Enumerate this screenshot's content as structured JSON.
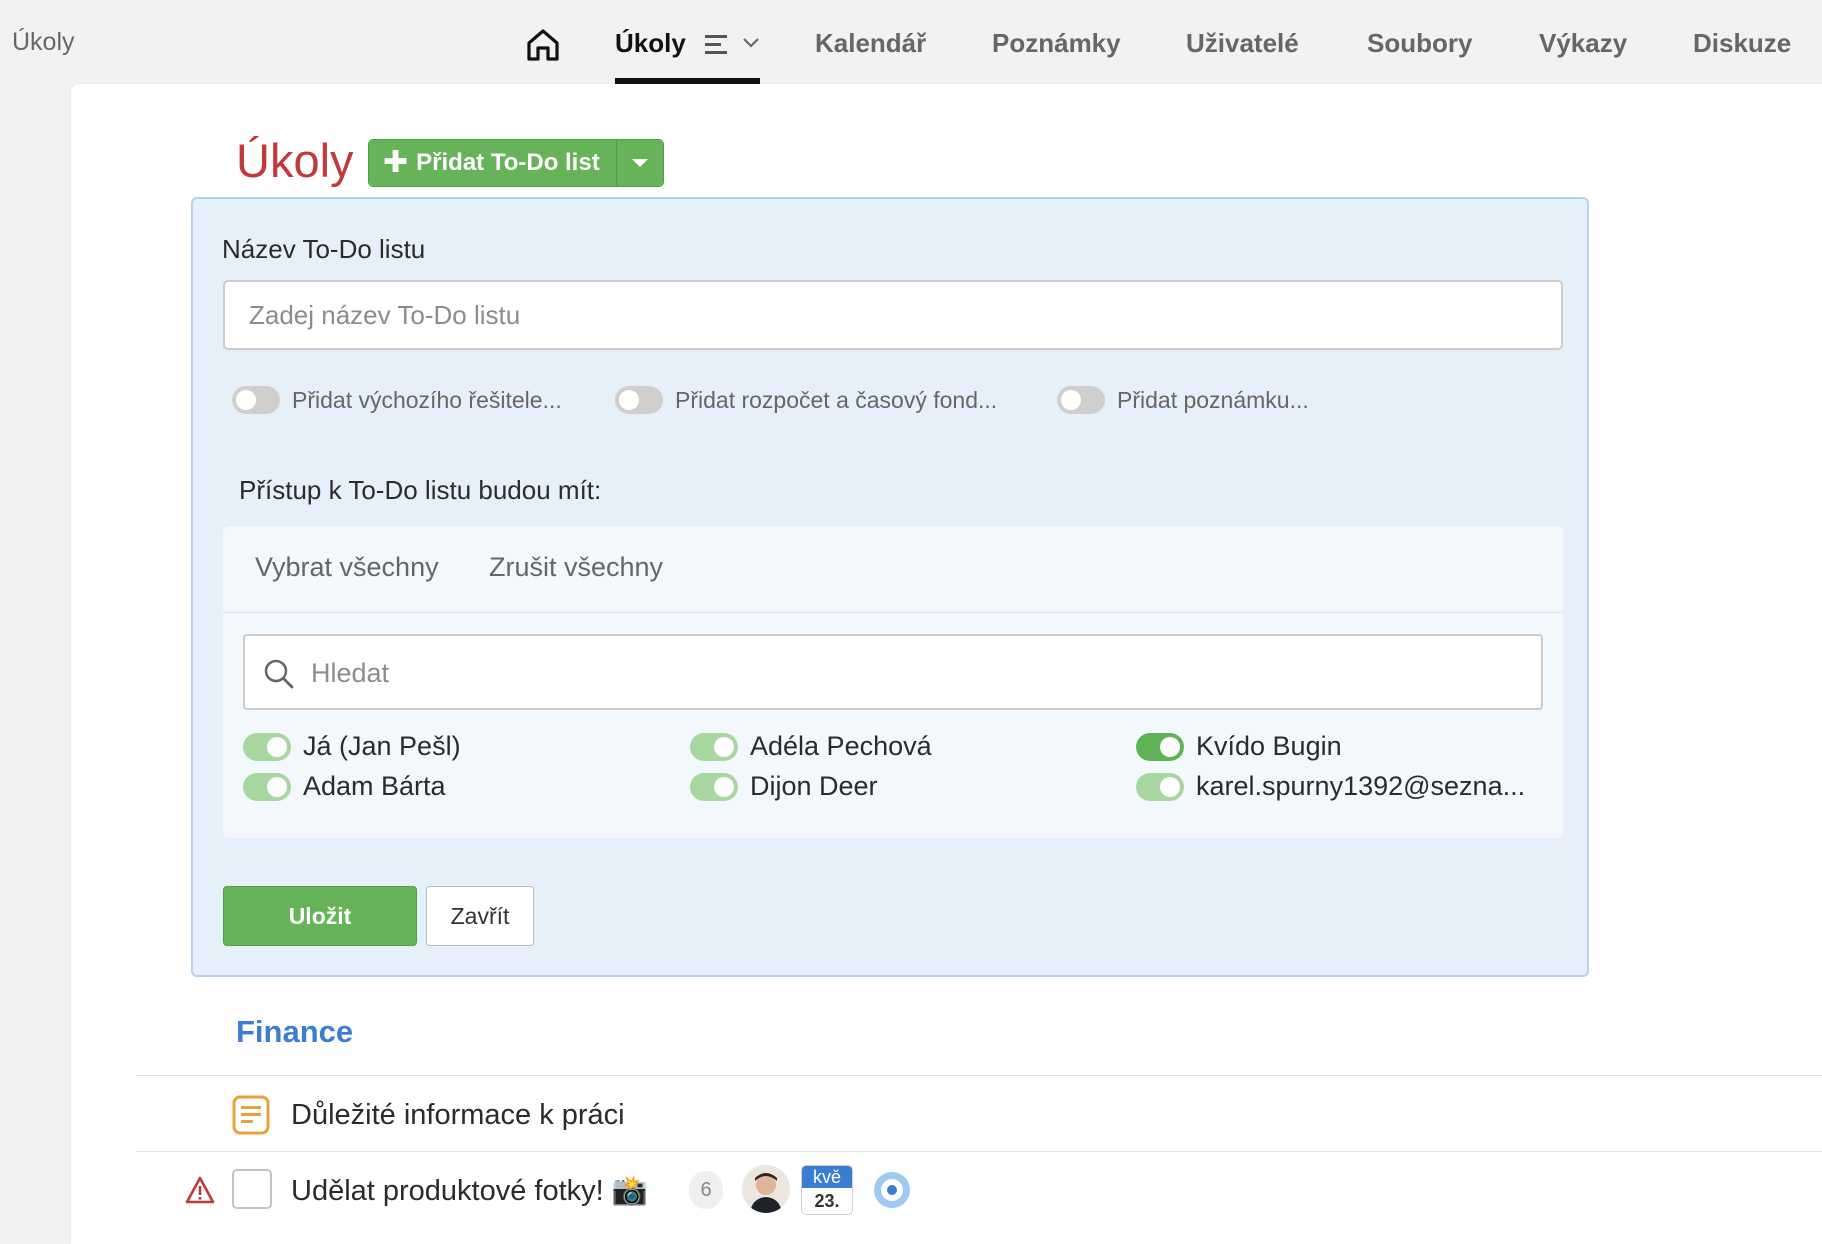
{
  "page_label": "Úkoly",
  "nav": {
    "items": [
      {
        "label": "Úkoly"
      },
      {
        "label": "Kalendář"
      },
      {
        "label": "Poznámky"
      },
      {
        "label": "Uživatelé"
      },
      {
        "label": "Soubory"
      },
      {
        "label": "Výkazy"
      },
      {
        "label": "Diskuze"
      }
    ]
  },
  "title": "Úkoly",
  "add_button_label": "Přidat To-Do list",
  "form": {
    "name_label": "Název To-Do listu",
    "name_placeholder": "Zadej název To-Do listu",
    "name_value": "",
    "options": [
      {
        "label": "Přidat výchozího řešitele...",
        "on": false
      },
      {
        "label": "Přidat rozpočet a časový fond...",
        "on": false
      },
      {
        "label": "Přidat poznámku...",
        "on": false
      }
    ],
    "access_label": "Přístup k To-Do listu budou mít:",
    "select_all": "Vybrat všechny",
    "deselect_all": "Zrušit všechny",
    "search_placeholder": "Hledat",
    "users": [
      {
        "name": "Já (Jan Pešl)",
        "on": true
      },
      {
        "name": "Adam Bárta",
        "on": true
      },
      {
        "name": "Adéla Pechová",
        "on": true
      },
      {
        "name": "Dijon Deer",
        "on": true
      },
      {
        "name": "Kvído Bugin",
        "on": true
      },
      {
        "name": "karel.spurny1392@sezna...",
        "on": true
      }
    ],
    "save_label": "Uložit",
    "close_label": "Zavřít"
  },
  "section": {
    "title": "Finance",
    "note_item": "Důležité informace k práci",
    "task": {
      "title": "Udělat produktové fotky! 📸",
      "comment_count": "6",
      "due_month": "kvě",
      "due_day": "23."
    }
  },
  "colors": {
    "accent_red": "#c0393b",
    "accent_green": "#67b35a",
    "accent_blue": "#3b7dd1",
    "panel_bg": "#e6f0fb"
  }
}
